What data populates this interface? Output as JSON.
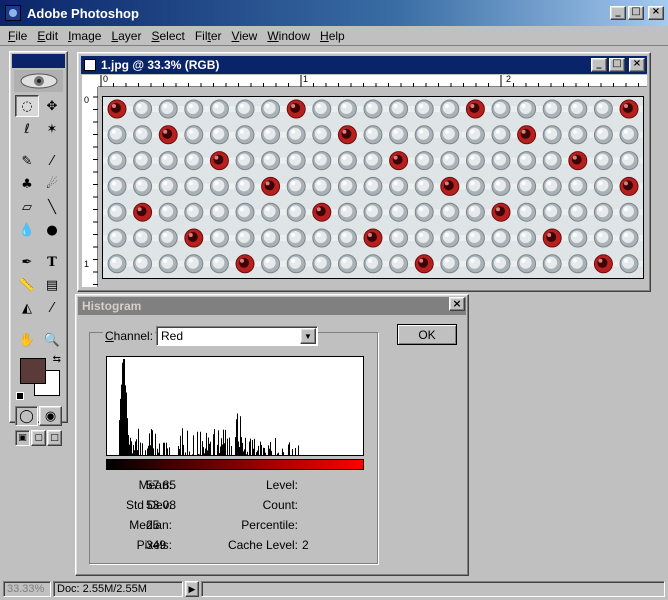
{
  "app": {
    "title": "Adobe Photoshop"
  },
  "menu": [
    {
      "u": "F",
      "rest": "ile"
    },
    {
      "u": "E",
      "rest": "dit"
    },
    {
      "u": "I",
      "rest": "mage"
    },
    {
      "u": "L",
      "rest": "ayer"
    },
    {
      "u": "S",
      "rest": "elect"
    },
    {
      "u": "",
      "pre": "Fil",
      "u2": "t",
      "rest": "er"
    },
    {
      "u": "V",
      "rest": "iew"
    },
    {
      "u": "W",
      "rest": "indow"
    },
    {
      "u": "H",
      "rest": "elp"
    }
  ],
  "document": {
    "title": "1.jpg @ 33.3% (RGB)",
    "ruler_top": [
      "0",
      "1",
      "2"
    ],
    "ruler_left": [
      "0",
      "1"
    ]
  },
  "plate": {
    "rows": 7,
    "cols": 21,
    "red_wells": [
      [
        0,
        0
      ],
      [
        0,
        7
      ],
      [
        0,
        14
      ],
      [
        0,
        20
      ],
      [
        1,
        2
      ],
      [
        1,
        9
      ],
      [
        1,
        16
      ],
      [
        2,
        4
      ],
      [
        2,
        11
      ],
      [
        2,
        18
      ],
      [
        3,
        6
      ],
      [
        3,
        13
      ],
      [
        3,
        20
      ],
      [
        4,
        1
      ],
      [
        4,
        8
      ],
      [
        4,
        15
      ],
      [
        5,
        3
      ],
      [
        5,
        10
      ],
      [
        5,
        17
      ],
      [
        6,
        5
      ],
      [
        6,
        12
      ],
      [
        6,
        19
      ]
    ]
  },
  "histogram": {
    "title": "Histogram",
    "channel_label_u": "C",
    "channel_label_rest": "hannel:",
    "channel_value": "Red",
    "ok_label": "OK",
    "stats_left": [
      {
        "label": "Mean:",
        "value": "57.85"
      },
      {
        "label": "Std Dev:",
        "value": "53.08"
      },
      {
        "label": "Median:",
        "value": "25"
      },
      {
        "label": "Pixels:",
        "value": "349"
      }
    ],
    "stats_right": [
      {
        "label": "Level:",
        "value": ""
      },
      {
        "label": "Count:",
        "value": ""
      },
      {
        "label": "Percentile:",
        "value": ""
      },
      {
        "label": "Cache Level:",
        "value": "2"
      }
    ]
  },
  "status": {
    "zoom": "33.33%",
    "doc": "Doc: 2.55M/2.55M"
  },
  "colors": {
    "foreground": "#5b3a3a",
    "background": "#ffffff",
    "title_active": "#0a246a",
    "title_inactive": "#808080"
  }
}
